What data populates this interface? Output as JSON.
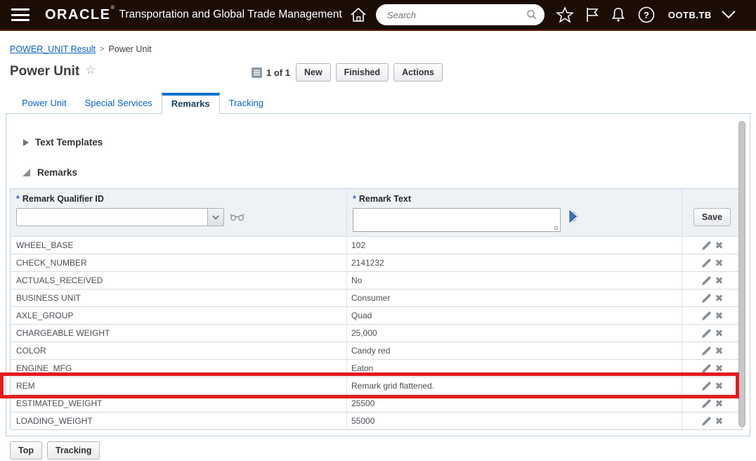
{
  "header": {
    "brand": "ORACLE",
    "title": "Transportation and Global Trade Management",
    "search_placeholder": "Search",
    "user": "OOTB.TB"
  },
  "breadcrumb": {
    "link": "POWER_UNIT Result",
    "separator": ">",
    "current": "Power Unit"
  },
  "page": {
    "title": "Power Unit",
    "record_position": "1 of 1",
    "buttons": {
      "new": "New",
      "finished": "Finished",
      "actions": "Actions"
    }
  },
  "tabs": {
    "items": [
      {
        "label": "Power Unit",
        "active": false
      },
      {
        "label": "Special Services",
        "active": false
      },
      {
        "label": "Remarks",
        "active": true
      },
      {
        "label": "Tracking",
        "active": false
      }
    ]
  },
  "sections": {
    "text_templates": "Text Templates",
    "remarks": "Remarks"
  },
  "table": {
    "required_marker": "*",
    "columns": [
      {
        "label": "Remark Qualifier ID",
        "required": true
      },
      {
        "label": "Remark Text",
        "required": true
      }
    ],
    "save_label": "Save",
    "qualifier_filter_value": "",
    "remark_text_filter_value": "",
    "rows": [
      {
        "qualifier": "WHEEL_BASE",
        "text": "102"
      },
      {
        "qualifier": "CHECK_NUMBER",
        "text": "2141232"
      },
      {
        "qualifier": "ACTUALS_RECEIVED",
        "text": "No"
      },
      {
        "qualifier": "BUSINESS UNIT",
        "text": "Consumer"
      },
      {
        "qualifier": "AXLE_GROUP",
        "text": "Quad"
      },
      {
        "qualifier": "CHARGEABLE WEIGHT",
        "text": "25,000"
      },
      {
        "qualifier": "COLOR",
        "text": "Candy red"
      },
      {
        "qualifier": "ENGINE_MFG",
        "text": "Eaton"
      },
      {
        "qualifier": "REM",
        "text": "Remark grid flattened."
      },
      {
        "qualifier": "ESTIMATED_WEIGHT",
        "text": "25500"
      },
      {
        "qualifier": "LOADING_WEIGHT",
        "text": "55000"
      }
    ],
    "highlighted_row_qualifier": "REM"
  },
  "footer": {
    "top": "Top",
    "tracking": "Tracking"
  },
  "colors": {
    "highlight_red": "#e21b1e",
    "tab_active_blue": "#0572ce",
    "link_blue": "#0b62c5",
    "topbar_bg": "#1b0d04"
  }
}
